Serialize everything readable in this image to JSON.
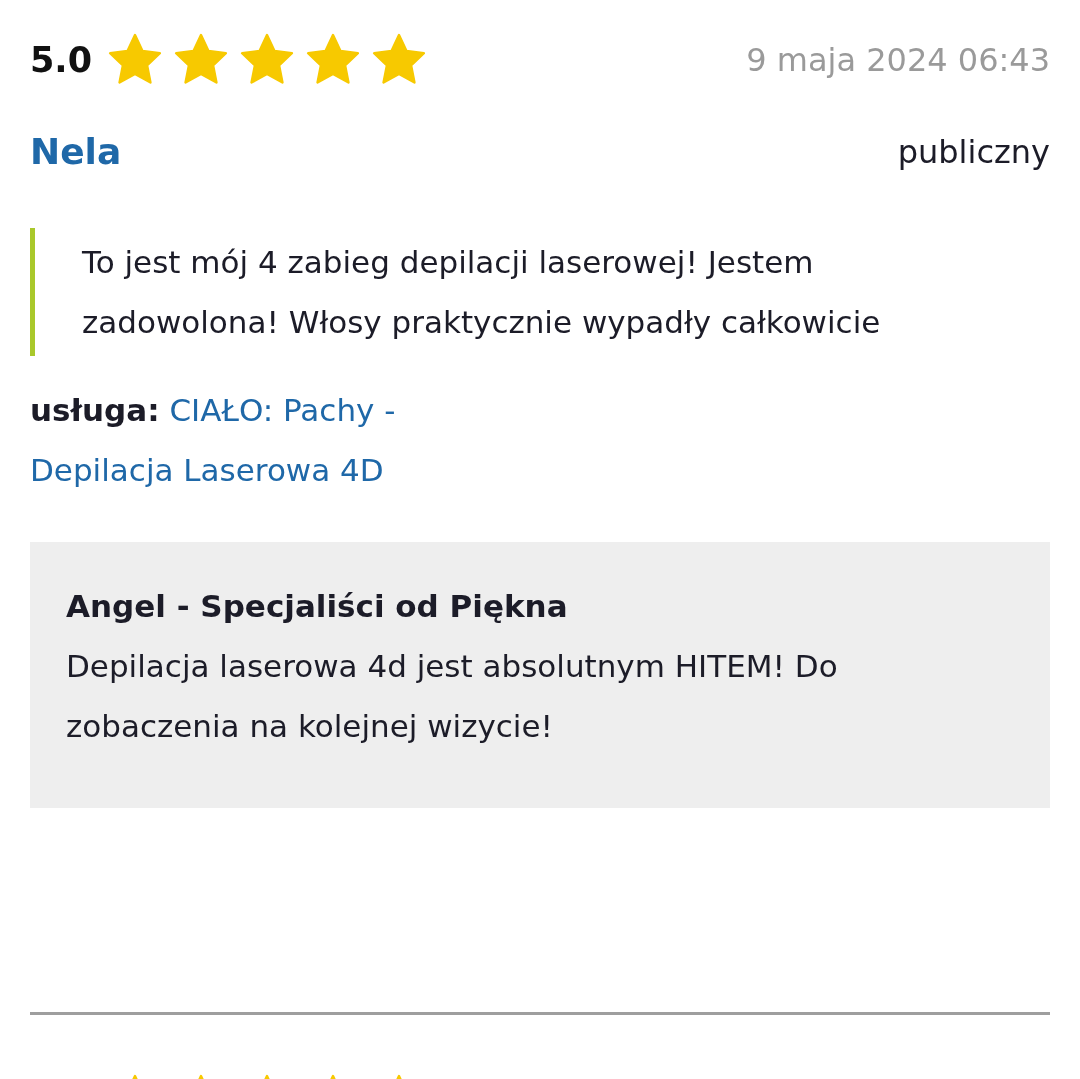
{
  "review": {
    "score": "5.0",
    "stars": 5,
    "date": "9 maja 2024 06:43",
    "author": "Nela",
    "visibility": "publiczny",
    "text": "To jest mój 4 zabieg depilacji laserowej! Jestem zadowolona! Włosy praktycznie wypadły całkowicie",
    "service_label": "usługa:",
    "service_lines": [
      "CIAŁO: Pachy -",
      "Depilacja Laserowa 4D"
    ],
    "reply": {
      "author": "Angel - Specjaliści od Piękna",
      "text": "Depilacja laserowa 4d jest absolutnym HITEM! Do zobaczenia na kolejnej wizycie!"
    }
  },
  "next_review": {
    "stars": 5
  }
}
